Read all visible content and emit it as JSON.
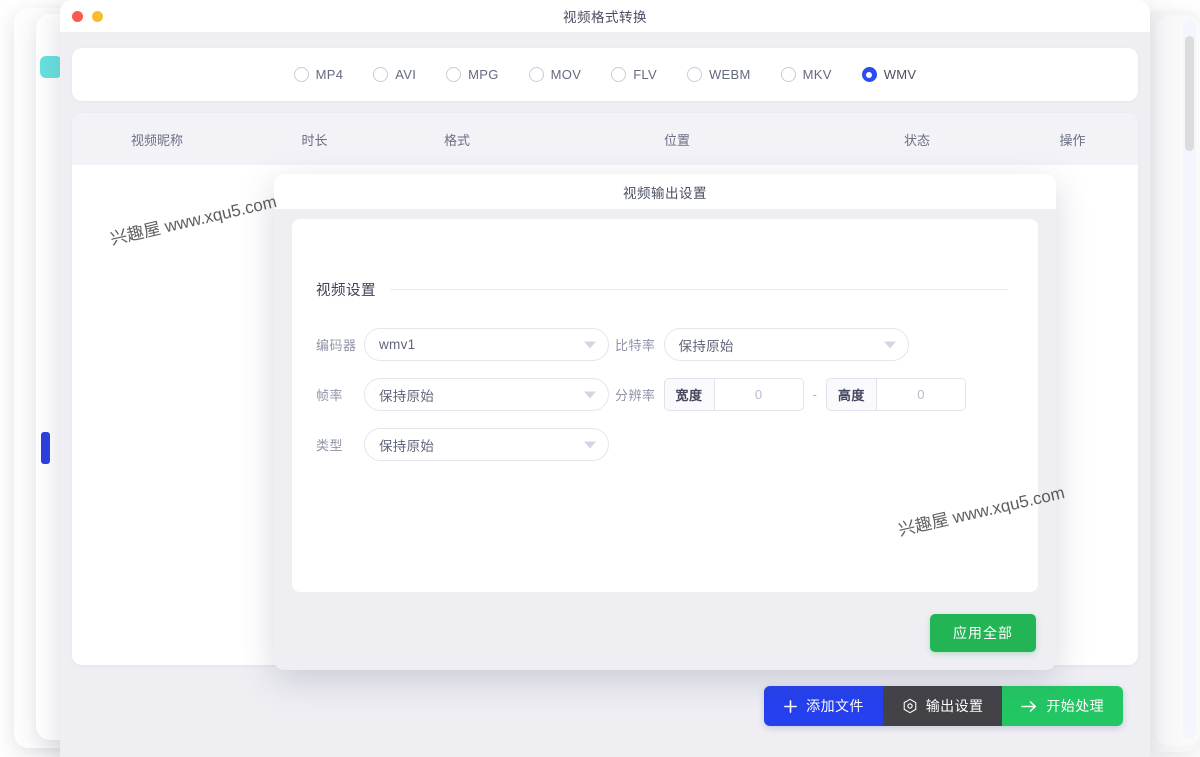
{
  "window": {
    "title": "视频格式转换",
    "controls": [
      {
        "name": "close",
        "color": "#f75b52"
      },
      {
        "name": "minimize",
        "color": "#f8bd2e"
      }
    ]
  },
  "formats": {
    "options": [
      {
        "label": "MP4",
        "selected": false
      },
      {
        "label": "AVI",
        "selected": false
      },
      {
        "label": "MPG",
        "selected": false
      },
      {
        "label": "MOV",
        "selected": false
      },
      {
        "label": "FLV",
        "selected": false
      },
      {
        "label": "WEBM",
        "selected": false
      },
      {
        "label": "MKV",
        "selected": false
      },
      {
        "label": "WMV",
        "selected": true
      }
    ],
    "selected_value": "WMV",
    "accent_color": "#2b4cf0"
  },
  "file_list": {
    "columns": [
      "视频昵称",
      "时长",
      "格式",
      "位置",
      "状态",
      "操作"
    ],
    "rows": []
  },
  "action_bar": {
    "add_file": "添加文件",
    "add_file_icon": "plus-icon",
    "output_settings": "输出设置",
    "output_settings_icon": "gear-icon",
    "start_process": "开始处理",
    "start_process_icon": "arrow-right-icon",
    "add_color": "#2440ef",
    "output_color": "#424247",
    "start_color": "#22c763"
  },
  "dialog": {
    "title": "视频输出设置",
    "section_title": "视频设置",
    "fields": {
      "encoder_label": "编码器",
      "encoder_value": "wmv1",
      "bitrate_label": "比特率",
      "bitrate_value": "保持原始",
      "framerate_label": "帧率",
      "framerate_value": "保持原始",
      "resolution_label": "分辨率",
      "width_label": "宽度",
      "width_value": "0",
      "height_label": "高度",
      "height_value": "0",
      "dash": "-",
      "type_label": "类型",
      "type_value": "保持原始"
    },
    "apply_all": "应用全部",
    "apply_color": "#22b455"
  },
  "watermark": {
    "text": "兴趣屋 www.xqu5.com"
  }
}
